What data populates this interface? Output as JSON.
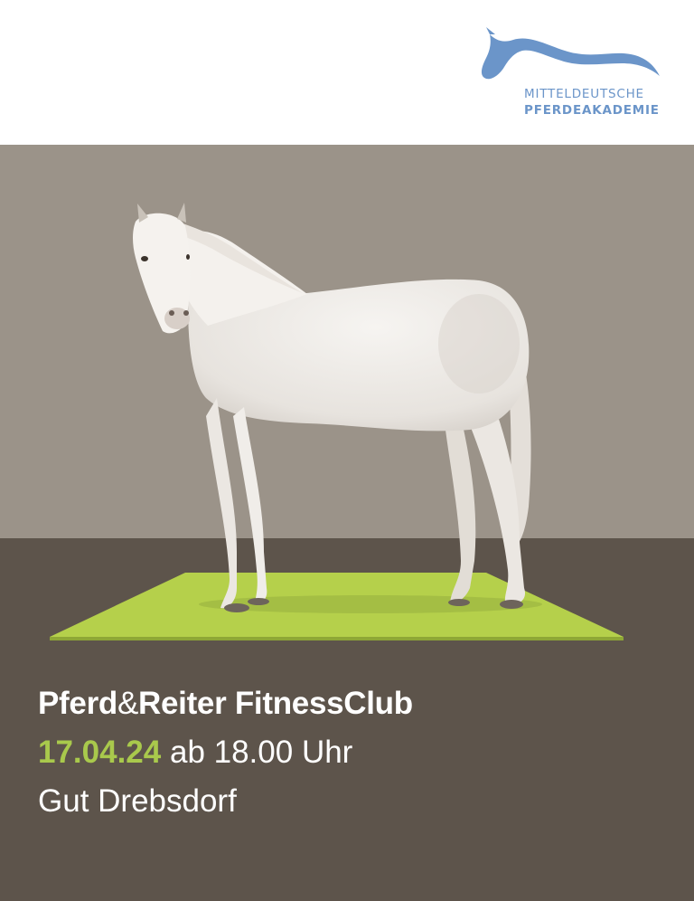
{
  "logo": {
    "line1": "MITTELDEUTSCHE",
    "line2": "PFERDEAKADEMIE",
    "icon": "horse-head-logo-icon",
    "color": "#6b95c9"
  },
  "image": {
    "subject": "white-horse-standing-on-mat",
    "mat_color": "#b5d04b",
    "backdrop_color": "#9b9389",
    "floor_color": "#5d544b"
  },
  "event": {
    "title_part1": "Pferd",
    "title_amp": "&",
    "title_part2": "Reiter FitnessClub",
    "date": "17.04.24",
    "time": " ab 18.00 Uhr",
    "location": "Gut Drebsdorf",
    "accent_color": "#a9c94c"
  }
}
